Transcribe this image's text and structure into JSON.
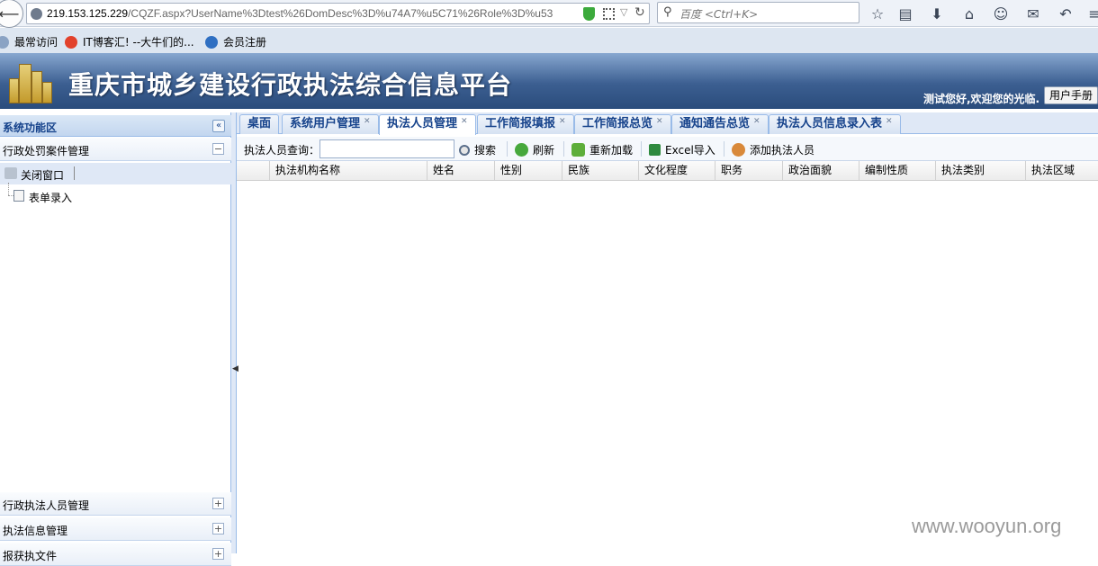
{
  "browser": {
    "url_host": "219.153.125.229",
    "url_path": "/CQZF.aspx?UserName%3Dtest%26DomDesc%3D%u74A7%u5C71%26Role%3D%u53",
    "search_placeholder": "百度 <Ctrl+K>",
    "bookmarks": [
      "最常访问",
      "IT博客汇! --大牛们的...",
      "会员注册"
    ]
  },
  "app": {
    "title": "重庆市城乡建设行政执法综合信息平台",
    "welcome": "测试您好,欢迎您的光临.",
    "manual_button": "用户手册"
  },
  "sidebar": {
    "header": "系统功能区",
    "collapse_glyph": "«",
    "sections": [
      {
        "label": "行政处罚案件管理",
        "state": "−"
      },
      {
        "label": "行政执法人员管理",
        "state": "+"
      },
      {
        "label": "执法信息管理",
        "state": "+"
      },
      {
        "label": "报获执文件",
        "state": "+"
      }
    ],
    "tree": {
      "close_window": "关闭窗口",
      "form_entry": "表单录入"
    }
  },
  "tabs": [
    {
      "label": "桌面",
      "closable": false
    },
    {
      "label": "系统用户管理",
      "closable": true
    },
    {
      "label": "执法人员管理",
      "closable": true,
      "active": true
    },
    {
      "label": "工作简报填报",
      "closable": true
    },
    {
      "label": "工作简报总览",
      "closable": true
    },
    {
      "label": "通知通告总览",
      "closable": true
    },
    {
      "label": "执法人员信息录入表",
      "closable": true
    }
  ],
  "toolbar": {
    "query_label": "执法人员查询：",
    "query_value": "",
    "search": "搜索",
    "refresh": "刷新",
    "reload": "重新加载",
    "excel_import": "Excel导入",
    "add_person": "添加执法人员"
  },
  "grid": {
    "columns": [
      "执法机构名称",
      "姓名",
      "性别",
      "民族",
      "文化程度",
      "职务",
      "政治面貌",
      "编制性质",
      "执法类别",
      "执法区域"
    ],
    "rows": []
  },
  "watermark": "www.wooyun.org"
}
